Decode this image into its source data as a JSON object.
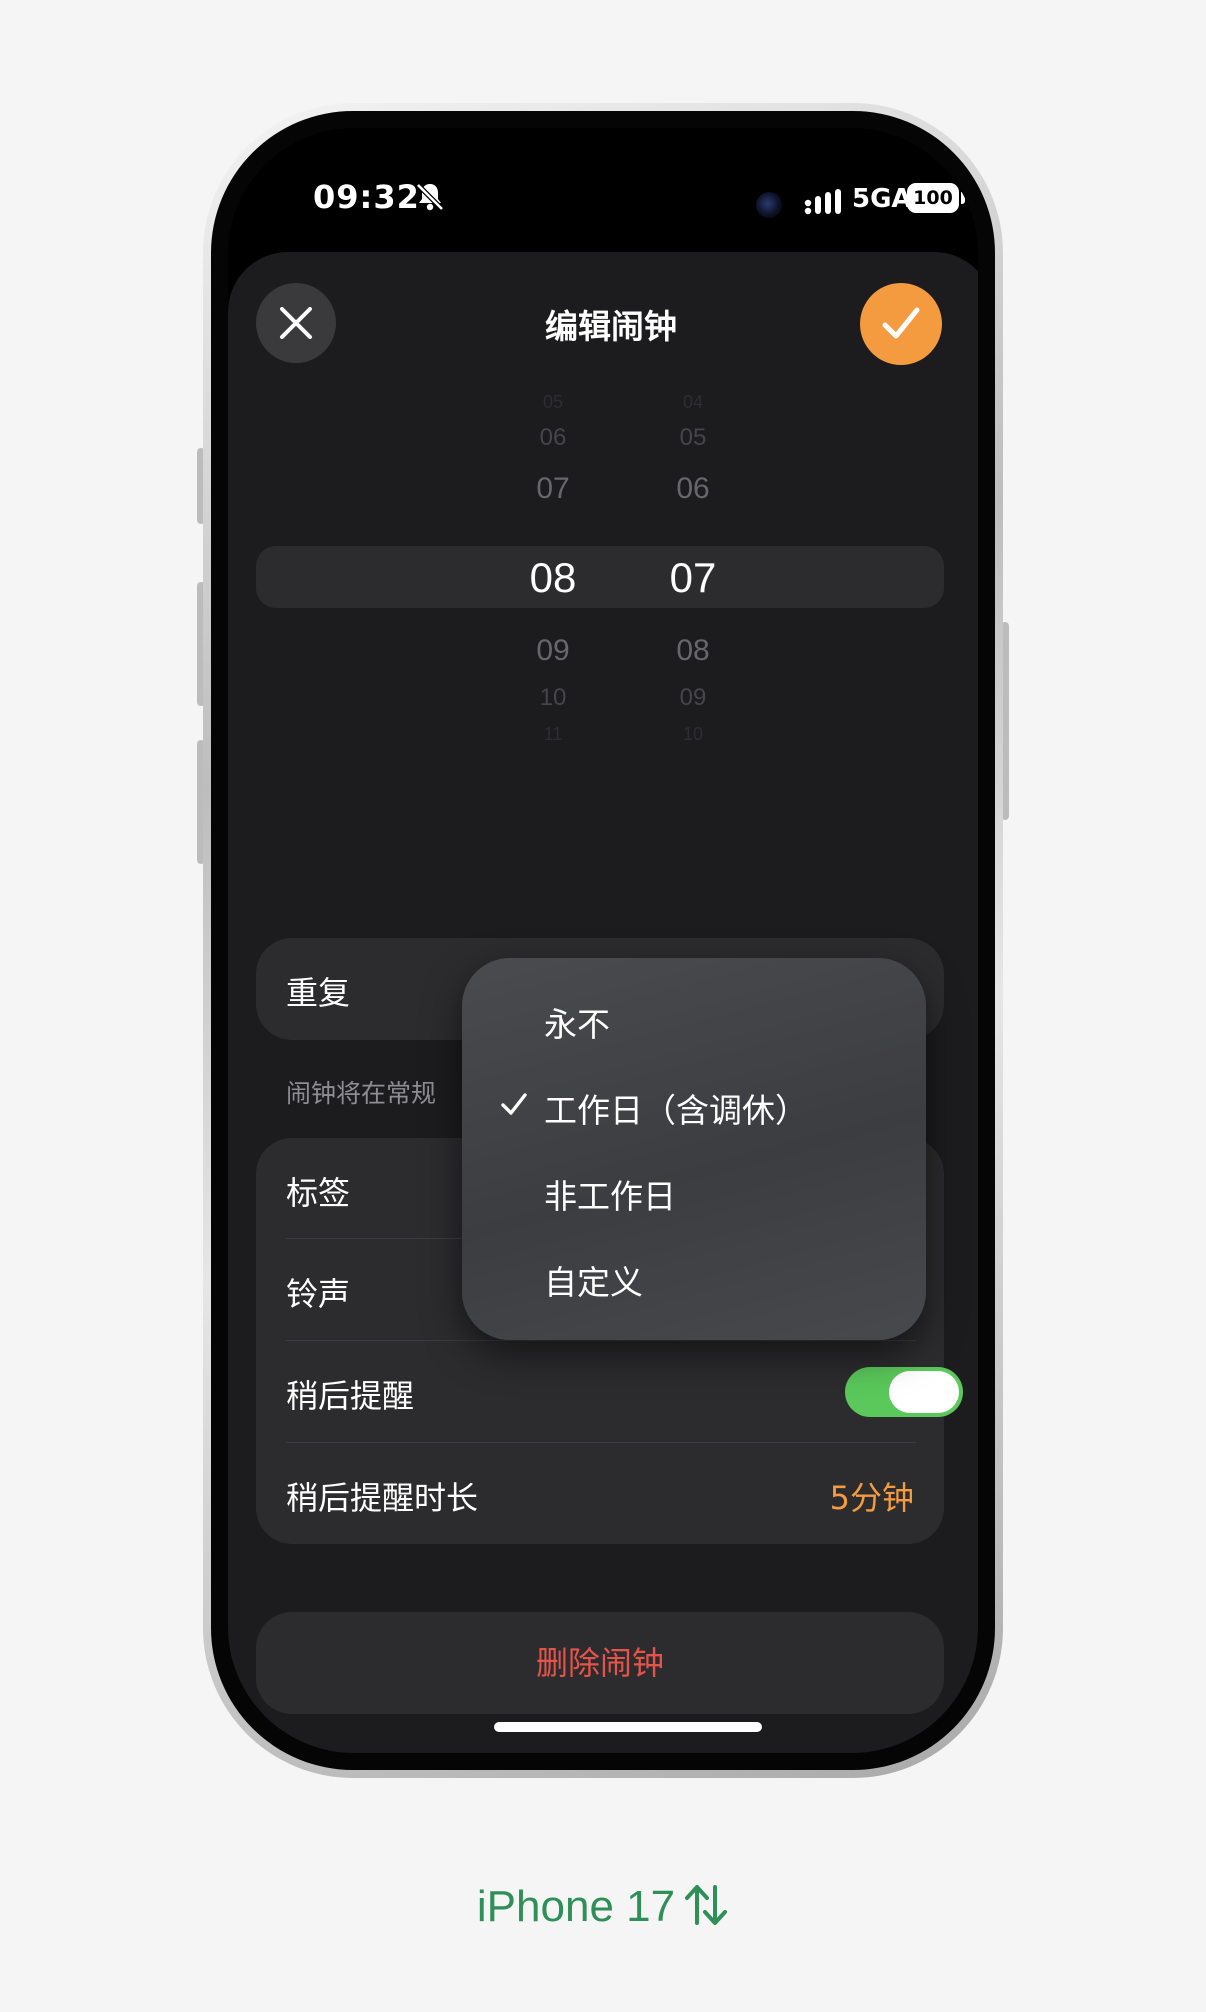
{
  "status_bar": {
    "time": "09:32",
    "network": "5GA",
    "battery": "100"
  },
  "sheet": {
    "title": "编辑闹钟",
    "close_icon": "close-icon",
    "confirm_icon": "checkmark-icon"
  },
  "picker": {
    "hours": [
      "05",
      "06",
      "07",
      "08",
      "09",
      "10",
      "11"
    ],
    "minutes": [
      "04",
      "05",
      "06",
      "07",
      "08",
      "09",
      "10"
    ],
    "selected_hour": "08",
    "selected_minute": "07"
  },
  "repeat": {
    "label": "重复",
    "footnote": "闹钟将在常规"
  },
  "settings": {
    "label_row": "标签",
    "sound_row": "铃声",
    "snooze_row": "稍后提醒",
    "snooze_on": true,
    "snooze_duration_row": "稍后提醒时长",
    "snooze_duration_value": "5分钟"
  },
  "delete": {
    "label": "删除闹钟"
  },
  "repeat_menu": {
    "options": [
      "永不",
      "工作日（含调休）",
      "非工作日",
      "自定义"
    ],
    "selected_index": 1
  },
  "caption": {
    "text": "iPhone 17"
  },
  "colors": {
    "accent": "#f49a3f",
    "toggle_on": "#5ac85a",
    "destructive": "#e5534b",
    "caption": "#2f8f58"
  }
}
